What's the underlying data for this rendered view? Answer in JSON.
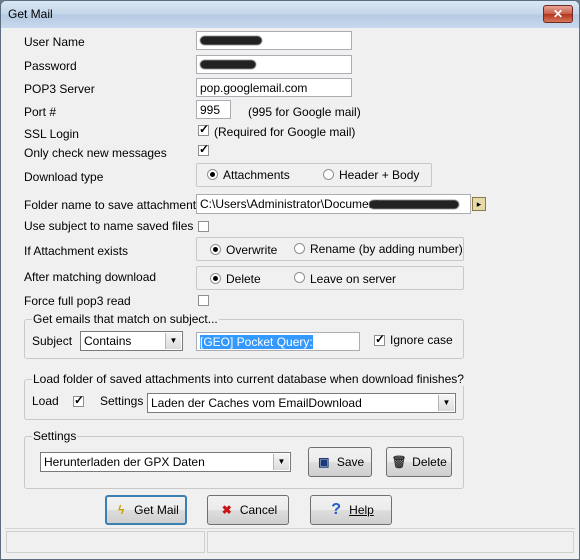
{
  "window": {
    "title": "Get Mail",
    "close_icon": "close-icon"
  },
  "form": {
    "user_name_label": "User Name",
    "password_label": "Password",
    "pop3_server_label": "POP3 Server",
    "pop3_server_value": "pop.googlemail.com",
    "port_label": "Port #",
    "port_value": "995",
    "port_hint": "(995 for Google mail)",
    "ssl_label": "SSL Login",
    "ssl_checked": true,
    "ssl_hint": "(Required for Google mail)",
    "only_new_label": "Only check new messages",
    "only_new_checked": true,
    "download_type_label": "Download type",
    "download_type_options": [
      "Attachments",
      "Header + Body"
    ],
    "folder_label": "Folder name to save attachments",
    "folder_value": "C:\\Users\\Administrator\\Documents",
    "use_subject_label": "Use subject to name saved files",
    "use_subject_checked": false,
    "if_exists_label": "If Attachment exists",
    "if_exists_options": [
      "Overwrite",
      "Rename (by adding number)"
    ],
    "after_match_label": "After matching download",
    "after_match_options": [
      "Delete",
      "Leave on server"
    ],
    "force_pop3_label": "Force full pop3 read",
    "force_pop3_checked": false
  },
  "match_group": {
    "legend": "Get emails that match on subject...",
    "subject_label": "Subject",
    "subject_operator": "Contains",
    "subject_value": "[GEO] Pocket Query:",
    "ignore_case_label": "Ignore case",
    "ignore_case_checked": true
  },
  "load_group": {
    "legend": "Load folder of saved attachments into current database when download finishes?",
    "load_label": "Load",
    "load_checked": true,
    "settings_label": "Settings",
    "settings_value": "Laden der Caches vom EmailDownload"
  },
  "settings_group": {
    "legend": "Settings",
    "selected": "Herunterladen der GPX Daten",
    "save_label": "Save",
    "delete_label": "Delete"
  },
  "buttons": {
    "get_mail_label": "Get Mail",
    "cancel_label": "Cancel",
    "help_label": "Help"
  },
  "colors": {
    "selection": "#3399ff",
    "help_icon": "#1f5fbf",
    "cancel_icon": "#c81414",
    "get_mail_icon": "#c8a000"
  }
}
